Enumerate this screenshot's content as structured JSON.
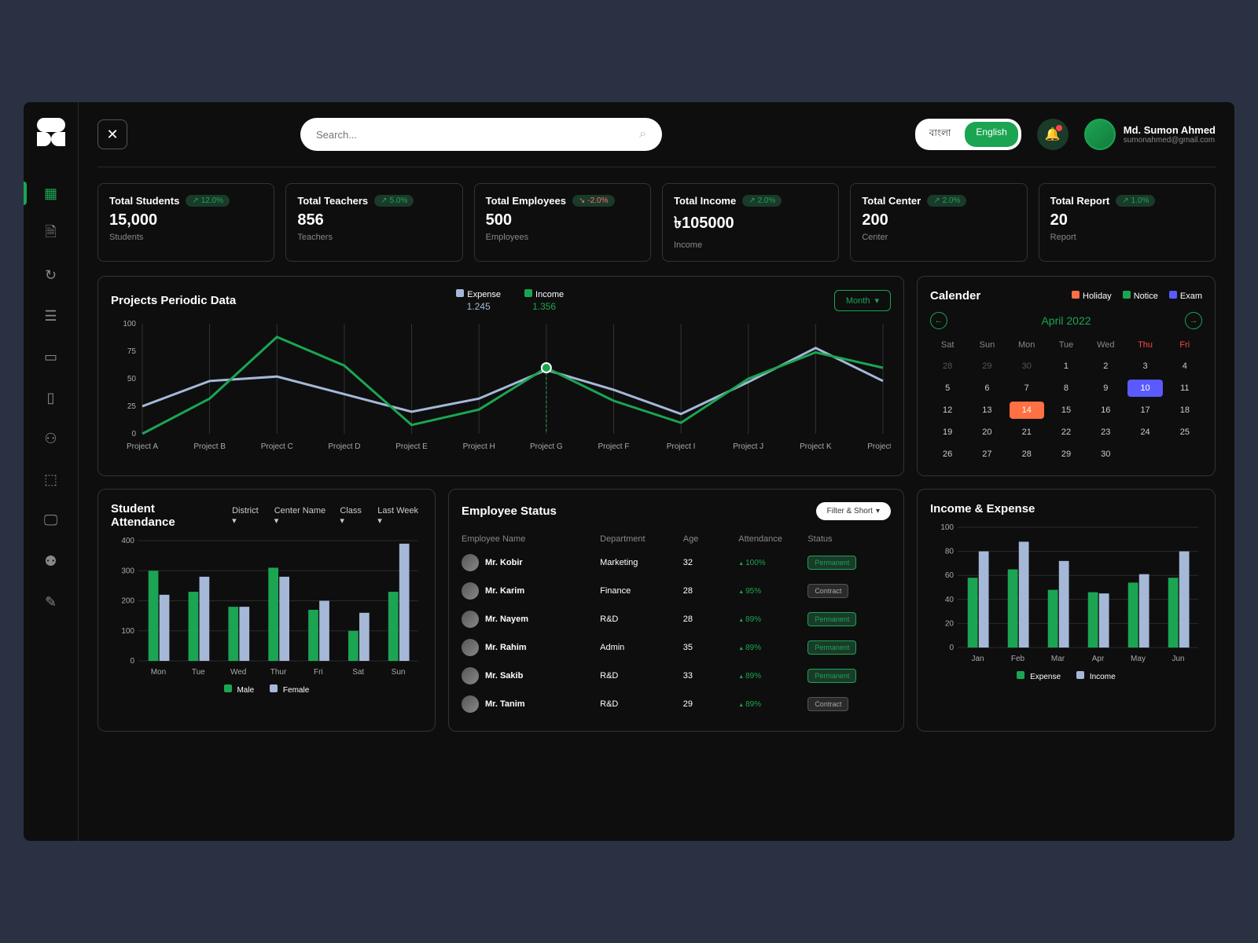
{
  "colors": {
    "accent": "#1ba552",
    "blue": "#a5b8d8",
    "holiday": "#ff7043",
    "notice": "#1ba552",
    "exam": "#5a5aff"
  },
  "header": {
    "search_placeholder": "Search...",
    "lang_bn": "বাংলা",
    "lang_en": "English",
    "user_name": "Md. Sumon Ahmed",
    "user_email": "sumonahmed@gmail.com"
  },
  "stats": [
    {
      "title": "Total Students",
      "delta": "12.0%",
      "dir": "up",
      "value": "15,000",
      "sub": "Students"
    },
    {
      "title": "Total Teachers",
      "delta": "5.0%",
      "dir": "up",
      "value": "856",
      "sub": "Teachers"
    },
    {
      "title": "Total Employees",
      "delta": "-2.0%",
      "dir": "down",
      "value": "500",
      "sub": "Employees"
    },
    {
      "title": "Total Income",
      "delta": "2.0%",
      "dir": "up",
      "value": "৳105000",
      "sub": "Income"
    },
    {
      "title": "Total Center",
      "delta": "2.0%",
      "dir": "up",
      "value": "200",
      "sub": "Center"
    },
    {
      "title": "Total Report",
      "delta": "1.0%",
      "dir": "up",
      "value": "20",
      "sub": "Report"
    }
  ],
  "periodic": {
    "title": "Projects Periodic Data",
    "legend": [
      {
        "name": "Expense",
        "value": "1.245",
        "color": "#a5b8d8"
      },
      {
        "name": "Income",
        "value": "1.356",
        "color": "#1ba552"
      }
    ],
    "dropdown": "Month"
  },
  "calendar": {
    "title": "Calender",
    "legend": [
      {
        "name": "Holiday",
        "color": "#ff7043"
      },
      {
        "name": "Notice",
        "color": "#1ba552"
      },
      {
        "name": "Exam",
        "color": "#5a5aff"
      }
    ],
    "month": "April 2022",
    "day_headers": [
      "Sat",
      "Sun",
      "Mon",
      "Tue",
      "Wed",
      "Thu",
      "Fri"
    ],
    "days": [
      {
        "n": "28",
        "dim": true
      },
      {
        "n": "29",
        "dim": true
      },
      {
        "n": "30",
        "dim": true
      },
      {
        "n": "1"
      },
      {
        "n": "2"
      },
      {
        "n": "3"
      },
      {
        "n": "4"
      },
      {
        "n": "5"
      },
      {
        "n": "6"
      },
      {
        "n": "7"
      },
      {
        "n": "8"
      },
      {
        "n": "9"
      },
      {
        "n": "10",
        "mark": "exam"
      },
      {
        "n": "11"
      },
      {
        "n": "12"
      },
      {
        "n": "13"
      },
      {
        "n": "14",
        "mark": "holiday"
      },
      {
        "n": "15"
      },
      {
        "n": "16"
      },
      {
        "n": "17"
      },
      {
        "n": "18"
      },
      {
        "n": "19"
      },
      {
        "n": "20"
      },
      {
        "n": "21"
      },
      {
        "n": "22"
      },
      {
        "n": "23"
      },
      {
        "n": "24"
      },
      {
        "n": "25"
      },
      {
        "n": "26"
      },
      {
        "n": "27"
      },
      {
        "n": "28"
      },
      {
        "n": "29"
      },
      {
        "n": "30"
      }
    ]
  },
  "attendance": {
    "title": "Student Attendance",
    "filters": [
      "District",
      "Center Name",
      "Class",
      "Last Week"
    ],
    "legend": [
      {
        "name": "Male",
        "color": "#1ba552"
      },
      {
        "name": "Female",
        "color": "#a5b8d8"
      }
    ]
  },
  "employees": {
    "title": "Employee Status",
    "filter_button": "Filter & Short",
    "columns": [
      "Employee Name",
      "Department",
      "Age",
      "Attendance",
      "Status"
    ],
    "rows": [
      {
        "name": "Mr. Kobir",
        "dept": "Marketing",
        "age": "32",
        "att": "100%",
        "status": "Permanent",
        "type": "perm"
      },
      {
        "name": "Mr. Karim",
        "dept": "Finance",
        "age": "28",
        "att": "95%",
        "status": "Contract",
        "type": "cont"
      },
      {
        "name": "Mr. Nayem",
        "dept": "R&D",
        "age": "28",
        "att": "89%",
        "status": "Permanent",
        "type": "perm"
      },
      {
        "name": "Mr. Rahim",
        "dept": "Admin",
        "age": "35",
        "att": "89%",
        "status": "Permanent",
        "type": "perm"
      },
      {
        "name": "Mr. Sakib",
        "dept": "R&D",
        "age": "33",
        "att": "89%",
        "status": "Permanent",
        "type": "perm"
      },
      {
        "name": "Mr. Tanim",
        "dept": "R&D",
        "age": "29",
        "att": "89%",
        "status": "Contract",
        "type": "cont"
      }
    ]
  },
  "income_expense": {
    "title": "Income & Expense",
    "legend": [
      {
        "name": "Expense",
        "color": "#1ba552"
      },
      {
        "name": "Income",
        "color": "#a5b8d8"
      }
    ]
  },
  "chart_data": [
    {
      "id": "periodic",
      "type": "line",
      "title": "Projects Periodic Data",
      "categories": [
        "Project A",
        "Project B",
        "Project C",
        "Project D",
        "Project E",
        "Project H",
        "Project G",
        "Project F",
        "Project I",
        "Project J",
        "Project K",
        "Project L"
      ],
      "series": [
        {
          "name": "Expense",
          "color": "#a5b8d8",
          "values": [
            25,
            48,
            52,
            36,
            20,
            32,
            58,
            40,
            18,
            47,
            78,
            48
          ]
        },
        {
          "name": "Income",
          "color": "#1ba552",
          "values": [
            0,
            32,
            88,
            62,
            8,
            22,
            60,
            30,
            10,
            50,
            74,
            60
          ]
        }
      ],
      "ylim": [
        0,
        100
      ],
      "yticks": [
        0,
        25,
        50,
        75,
        100
      ],
      "highlight_category": "Project G"
    },
    {
      "id": "attendance",
      "type": "bar",
      "title": "Student Attendance",
      "categories": [
        "Mon",
        "Tue",
        "Wed",
        "Thur",
        "Fri",
        "Sat",
        "Sun"
      ],
      "series": [
        {
          "name": "Male",
          "color": "#1ba552",
          "values": [
            300,
            230,
            180,
            310,
            170,
            100,
            230
          ]
        },
        {
          "name": "Female",
          "color": "#a5b8d8",
          "values": [
            220,
            280,
            180,
            280,
            200,
            160,
            390
          ]
        }
      ],
      "ylim": [
        0,
        400
      ],
      "yticks": [
        0,
        100,
        200,
        300,
        400
      ]
    },
    {
      "id": "income_expense",
      "type": "bar",
      "title": "Income & Expense",
      "categories": [
        "Jan",
        "Feb",
        "Mar",
        "Apr",
        "May",
        "Jun"
      ],
      "series": [
        {
          "name": "Expense",
          "color": "#1ba552",
          "values": [
            58,
            65,
            48,
            46,
            54,
            58
          ]
        },
        {
          "name": "Income",
          "color": "#a5b8d8",
          "values": [
            80,
            88,
            72,
            45,
            61,
            80
          ]
        }
      ],
      "ylim": [
        0,
        100
      ],
      "yticks": [
        0,
        20,
        40,
        60,
        80,
        100
      ]
    }
  ]
}
